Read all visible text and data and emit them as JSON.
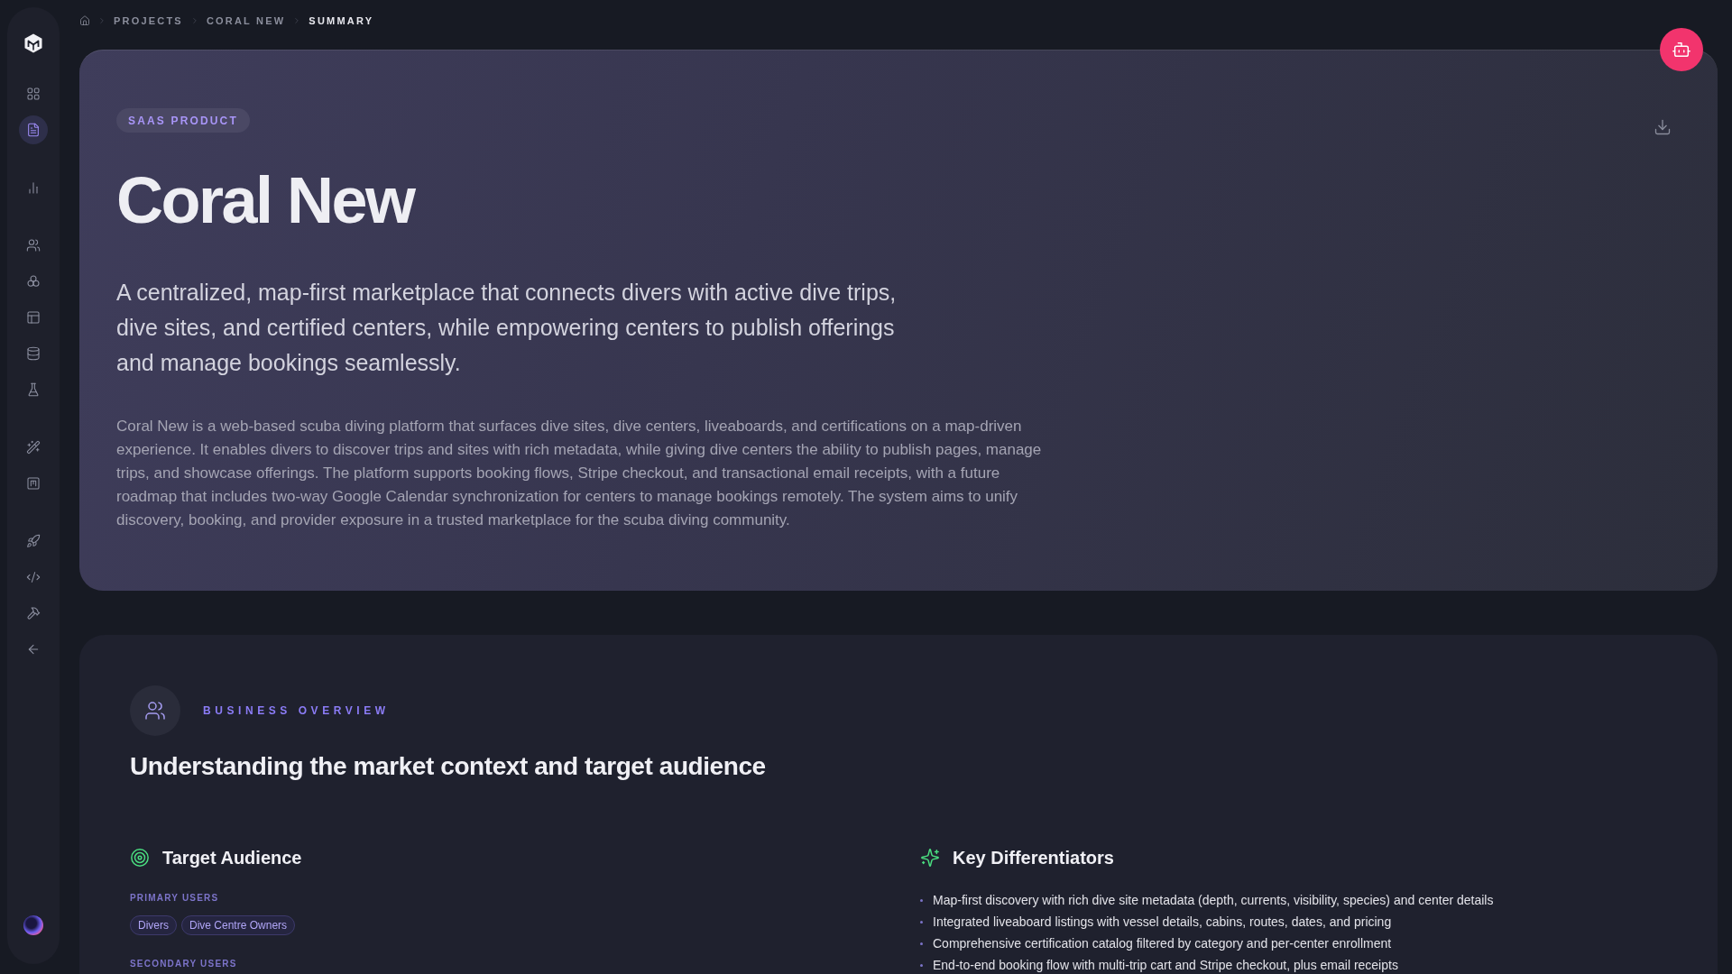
{
  "sidebar": {
    "groups": [
      {
        "items": [
          {
            "selected": false
          },
          {
            "selected": true
          }
        ]
      },
      {
        "items": [
          {
            "selected": false
          }
        ]
      },
      {
        "items": [
          {
            "selected": false
          },
          {
            "selected": false
          },
          {
            "selected": false
          },
          {
            "selected": false
          },
          {
            "selected": false
          }
        ]
      },
      {
        "items": [
          {
            "selected": false
          },
          {
            "selected": false
          }
        ]
      },
      {
        "items": [
          {
            "selected": false
          },
          {
            "selected": false
          },
          {
            "selected": false
          },
          {
            "selected": false
          }
        ]
      }
    ]
  },
  "breadcrumb": [
    {
      "label": "PROJECTS",
      "current": false
    },
    {
      "label": "CORAL NEW",
      "current": false
    },
    {
      "label": "SUMMARY",
      "current": true
    }
  ],
  "hero": {
    "badge": "SAAS PRODUCT",
    "title": "Coral New",
    "tagline": "A centralized, map-first marketplace that connects divers with active dive trips, dive sites, and certified centers, while empowering centers to publish offerings and manage bookings seamlessly.",
    "description": "Coral New is a web-based scuba diving platform that surfaces dive sites, dive centers, liveaboards, and certifications on a map-driven experience. It enables divers to discover trips and sites with rich metadata, while giving dive centers the ability to publish pages, manage trips, and showcase offerings. The platform supports booking flows, Stripe checkout, and transactional email receipts, with a future roadmap that includes two-way Google Calendar synchronization for centers to manage bookings remotely. The system aims to unify discovery, booking, and provider exposure in a trusted marketplace for the scuba diving community."
  },
  "business_overview": {
    "eyebrow": "BUSINESS OVERVIEW",
    "heading": "Understanding the market context and target audience",
    "target_audience": {
      "title": "Target Audience",
      "groups": [
        {
          "label": "PRIMARY USERS",
          "tags": [
            "Divers",
            "Dive Centre Owners"
          ]
        },
        {
          "label": "SECONDARY USERS"
        }
      ]
    },
    "key_differentiators": {
      "title": "Key Differentiators",
      "items": [
        "Map-first discovery with rich dive site metadata (depth, currents, visibility, species) and center details",
        "Integrated liveaboard listings with vessel details, cabins, routes, dates, and pricing",
        "Comprehensive certification catalog filtered by category and per-center enrollment",
        "End-to-end booking flow with multi-trip cart and Stripe checkout, plus email receipts"
      ]
    }
  }
}
